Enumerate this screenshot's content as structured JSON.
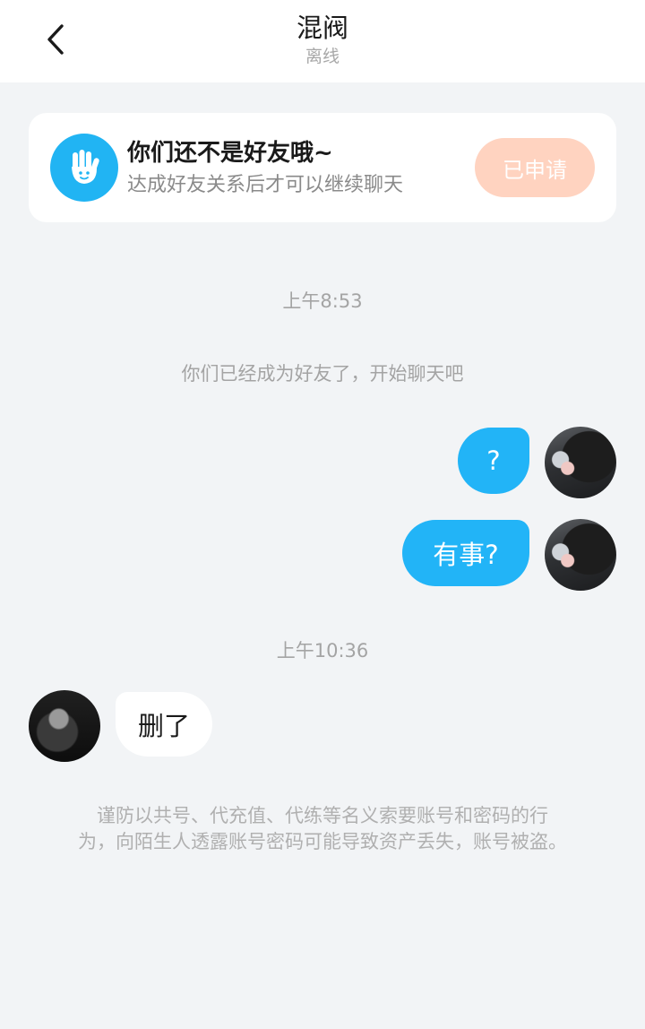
{
  "header": {
    "title": "混阀",
    "status": "离线"
  },
  "friend_card": {
    "title": "你们还不是好友哦~",
    "subtitle": "达成好友关系后才可以继续聊天",
    "button_label": "已申请"
  },
  "chat": {
    "time_1": "上午8:53",
    "system_notice": "你们已经成为好友了，开始聊天吧",
    "messages": [
      {
        "from": "me",
        "text": "?"
      },
      {
        "from": "me",
        "text": "有事?"
      },
      {
        "from": "peer",
        "text": "删了"
      }
    ],
    "time_2": "上午10:36"
  },
  "warning": {
    "line_1": "谨防以共号、代充值、代练等名义索要账号和密码的行",
    "line_2": "为，向陌生人透露账号密码可能导致资产丢失，账号被盗。"
  },
  "colors": {
    "accent": "#22b4f7",
    "applied_button": "#ffd3c0",
    "background": "#f2f4f6"
  },
  "icons": {
    "back": "chevron-left-icon",
    "card": "waving-hand-icon"
  }
}
